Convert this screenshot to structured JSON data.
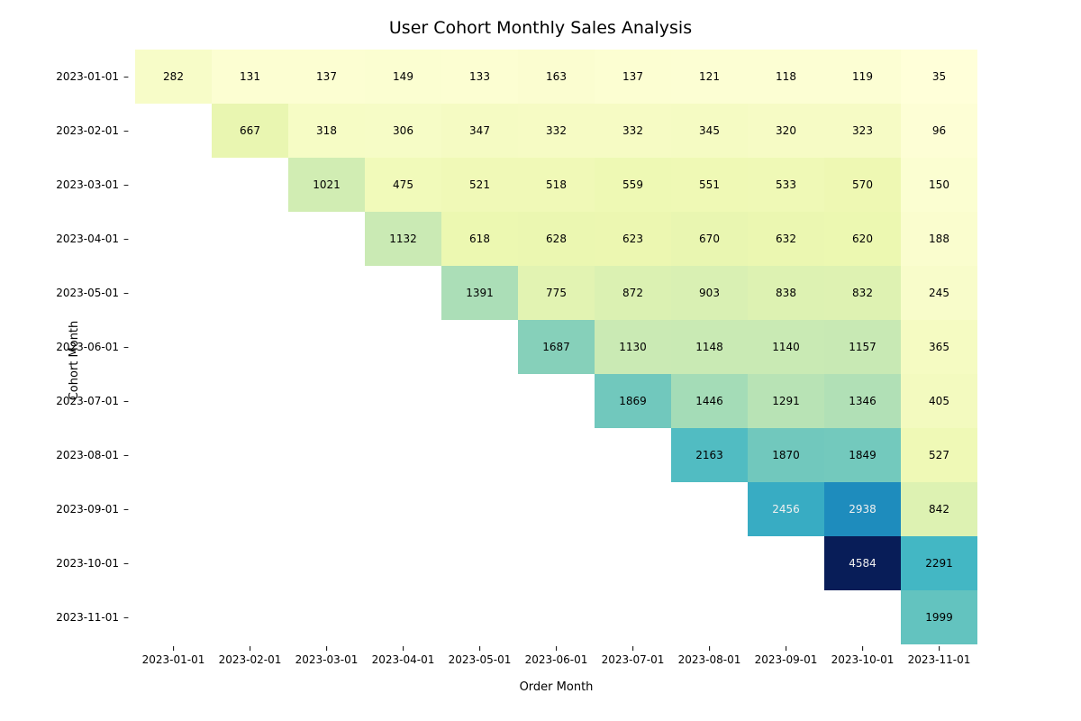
{
  "chart_data": {
    "type": "heatmap",
    "title": "User Cohort Monthly Sales Analysis",
    "xlabel": "Order Month",
    "ylabel": "Cohort Month",
    "x_categories": [
      "2023-01-01",
      "2023-02-01",
      "2023-03-01",
      "2023-04-01",
      "2023-05-01",
      "2023-06-01",
      "2023-07-01",
      "2023-08-01",
      "2023-09-01",
      "2023-10-01",
      "2023-11-01"
    ],
    "y_categories": [
      "2023-01-01",
      "2023-02-01",
      "2023-03-01",
      "2023-04-01",
      "2023-05-01",
      "2023-06-01",
      "2023-07-01",
      "2023-08-01",
      "2023-09-01",
      "2023-10-01",
      "2023-11-01"
    ],
    "cmap": "YlGnBu",
    "vmin": 35,
    "vmax": 4584,
    "values": [
      [
        282,
        131,
        137,
        149,
        133,
        163,
        137,
        121,
        118,
        119,
        35
      ],
      [
        null,
        667,
        318,
        306,
        347,
        332,
        332,
        345,
        320,
        323,
        96
      ],
      [
        null,
        null,
        1021,
        475,
        521,
        518,
        559,
        551,
        533,
        570,
        150
      ],
      [
        null,
        null,
        null,
        1132,
        618,
        628,
        623,
        670,
        632,
        620,
        188
      ],
      [
        null,
        null,
        null,
        null,
        1391,
        775,
        872,
        903,
        838,
        832,
        245
      ],
      [
        null,
        null,
        null,
        null,
        null,
        1687,
        1130,
        1148,
        1140,
        1157,
        365
      ],
      [
        null,
        null,
        null,
        null,
        null,
        null,
        1869,
        1446,
        1291,
        1346,
        405
      ],
      [
        null,
        null,
        null,
        null,
        null,
        null,
        null,
        2163,
        1870,
        1849,
        527
      ],
      [
        null,
        null,
        null,
        null,
        null,
        null,
        null,
        null,
        2456,
        2938,
        842
      ],
      [
        null,
        null,
        null,
        null,
        null,
        null,
        null,
        null,
        null,
        4584,
        2291
      ],
      [
        null,
        null,
        null,
        null,
        null,
        null,
        null,
        null,
        null,
        null,
        1999
      ]
    ]
  }
}
